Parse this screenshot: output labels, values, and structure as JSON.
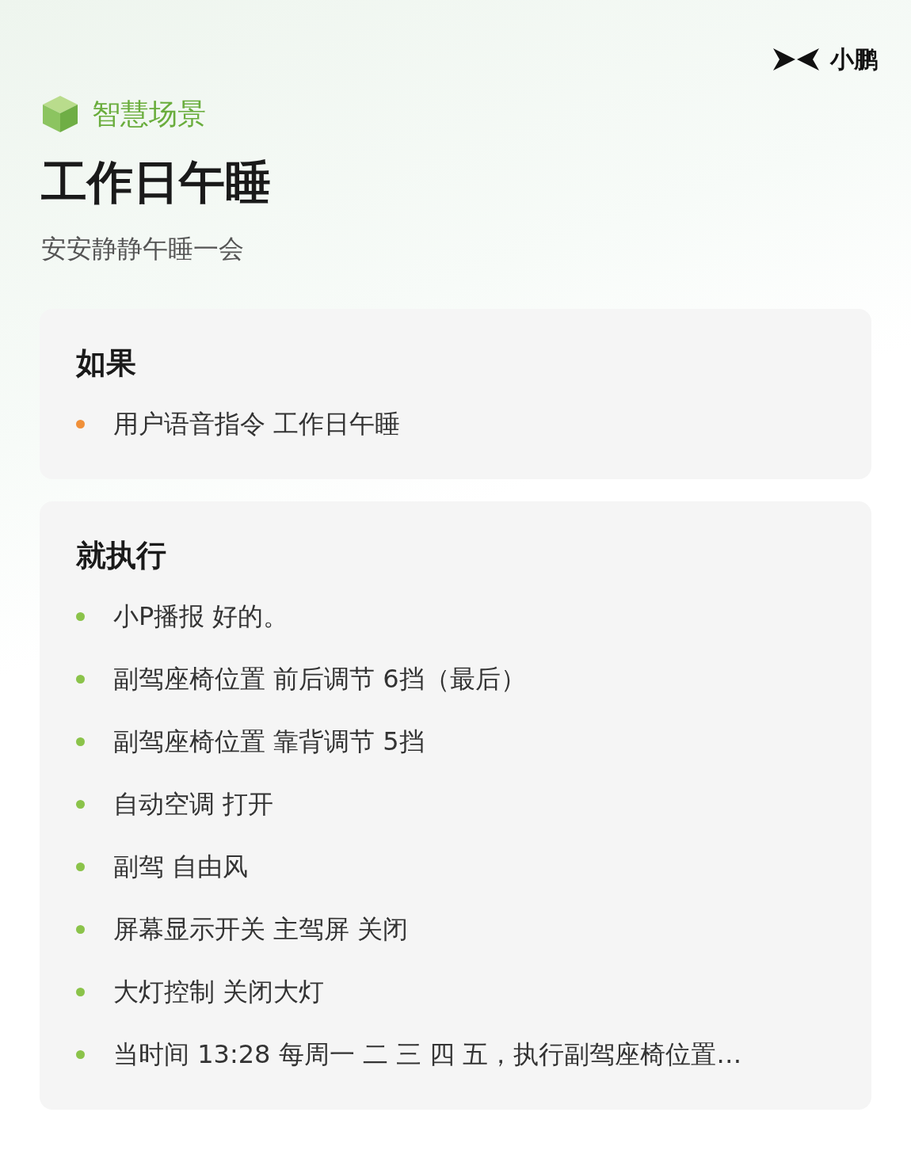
{
  "brand": "小鹏",
  "category": "智慧场景",
  "title": "工作日午睡",
  "subtitle": "安安静静午睡一会",
  "sections": [
    {
      "heading": "如果",
      "items": [
        {
          "text": "用户语音指令 工作日午睡",
          "color": "#f0903a"
        }
      ]
    },
    {
      "heading": "就执行",
      "items": [
        {
          "text": "小P播报 好的。",
          "color": "#8bc34a"
        },
        {
          "text": "副驾座椅位置 前后调节 6挡（最后）",
          "color": "#8bc34a"
        },
        {
          "text": "副驾座椅位置 靠背调节 5挡",
          "color": "#8bc34a"
        },
        {
          "text": "自动空调 打开",
          "color": "#8bc34a"
        },
        {
          "text": "副驾 自由风",
          "color": "#8bc34a"
        },
        {
          "text": "屏幕显示开关 主驾屏 关闭",
          "color": "#8bc34a"
        },
        {
          "text": "大灯控制 关闭大灯",
          "color": "#8bc34a"
        },
        {
          "text": "当时间 13:28 每周一 二 三 四 五，执行副驾座椅位置…",
          "color": "#8bc34a"
        }
      ]
    }
  ]
}
